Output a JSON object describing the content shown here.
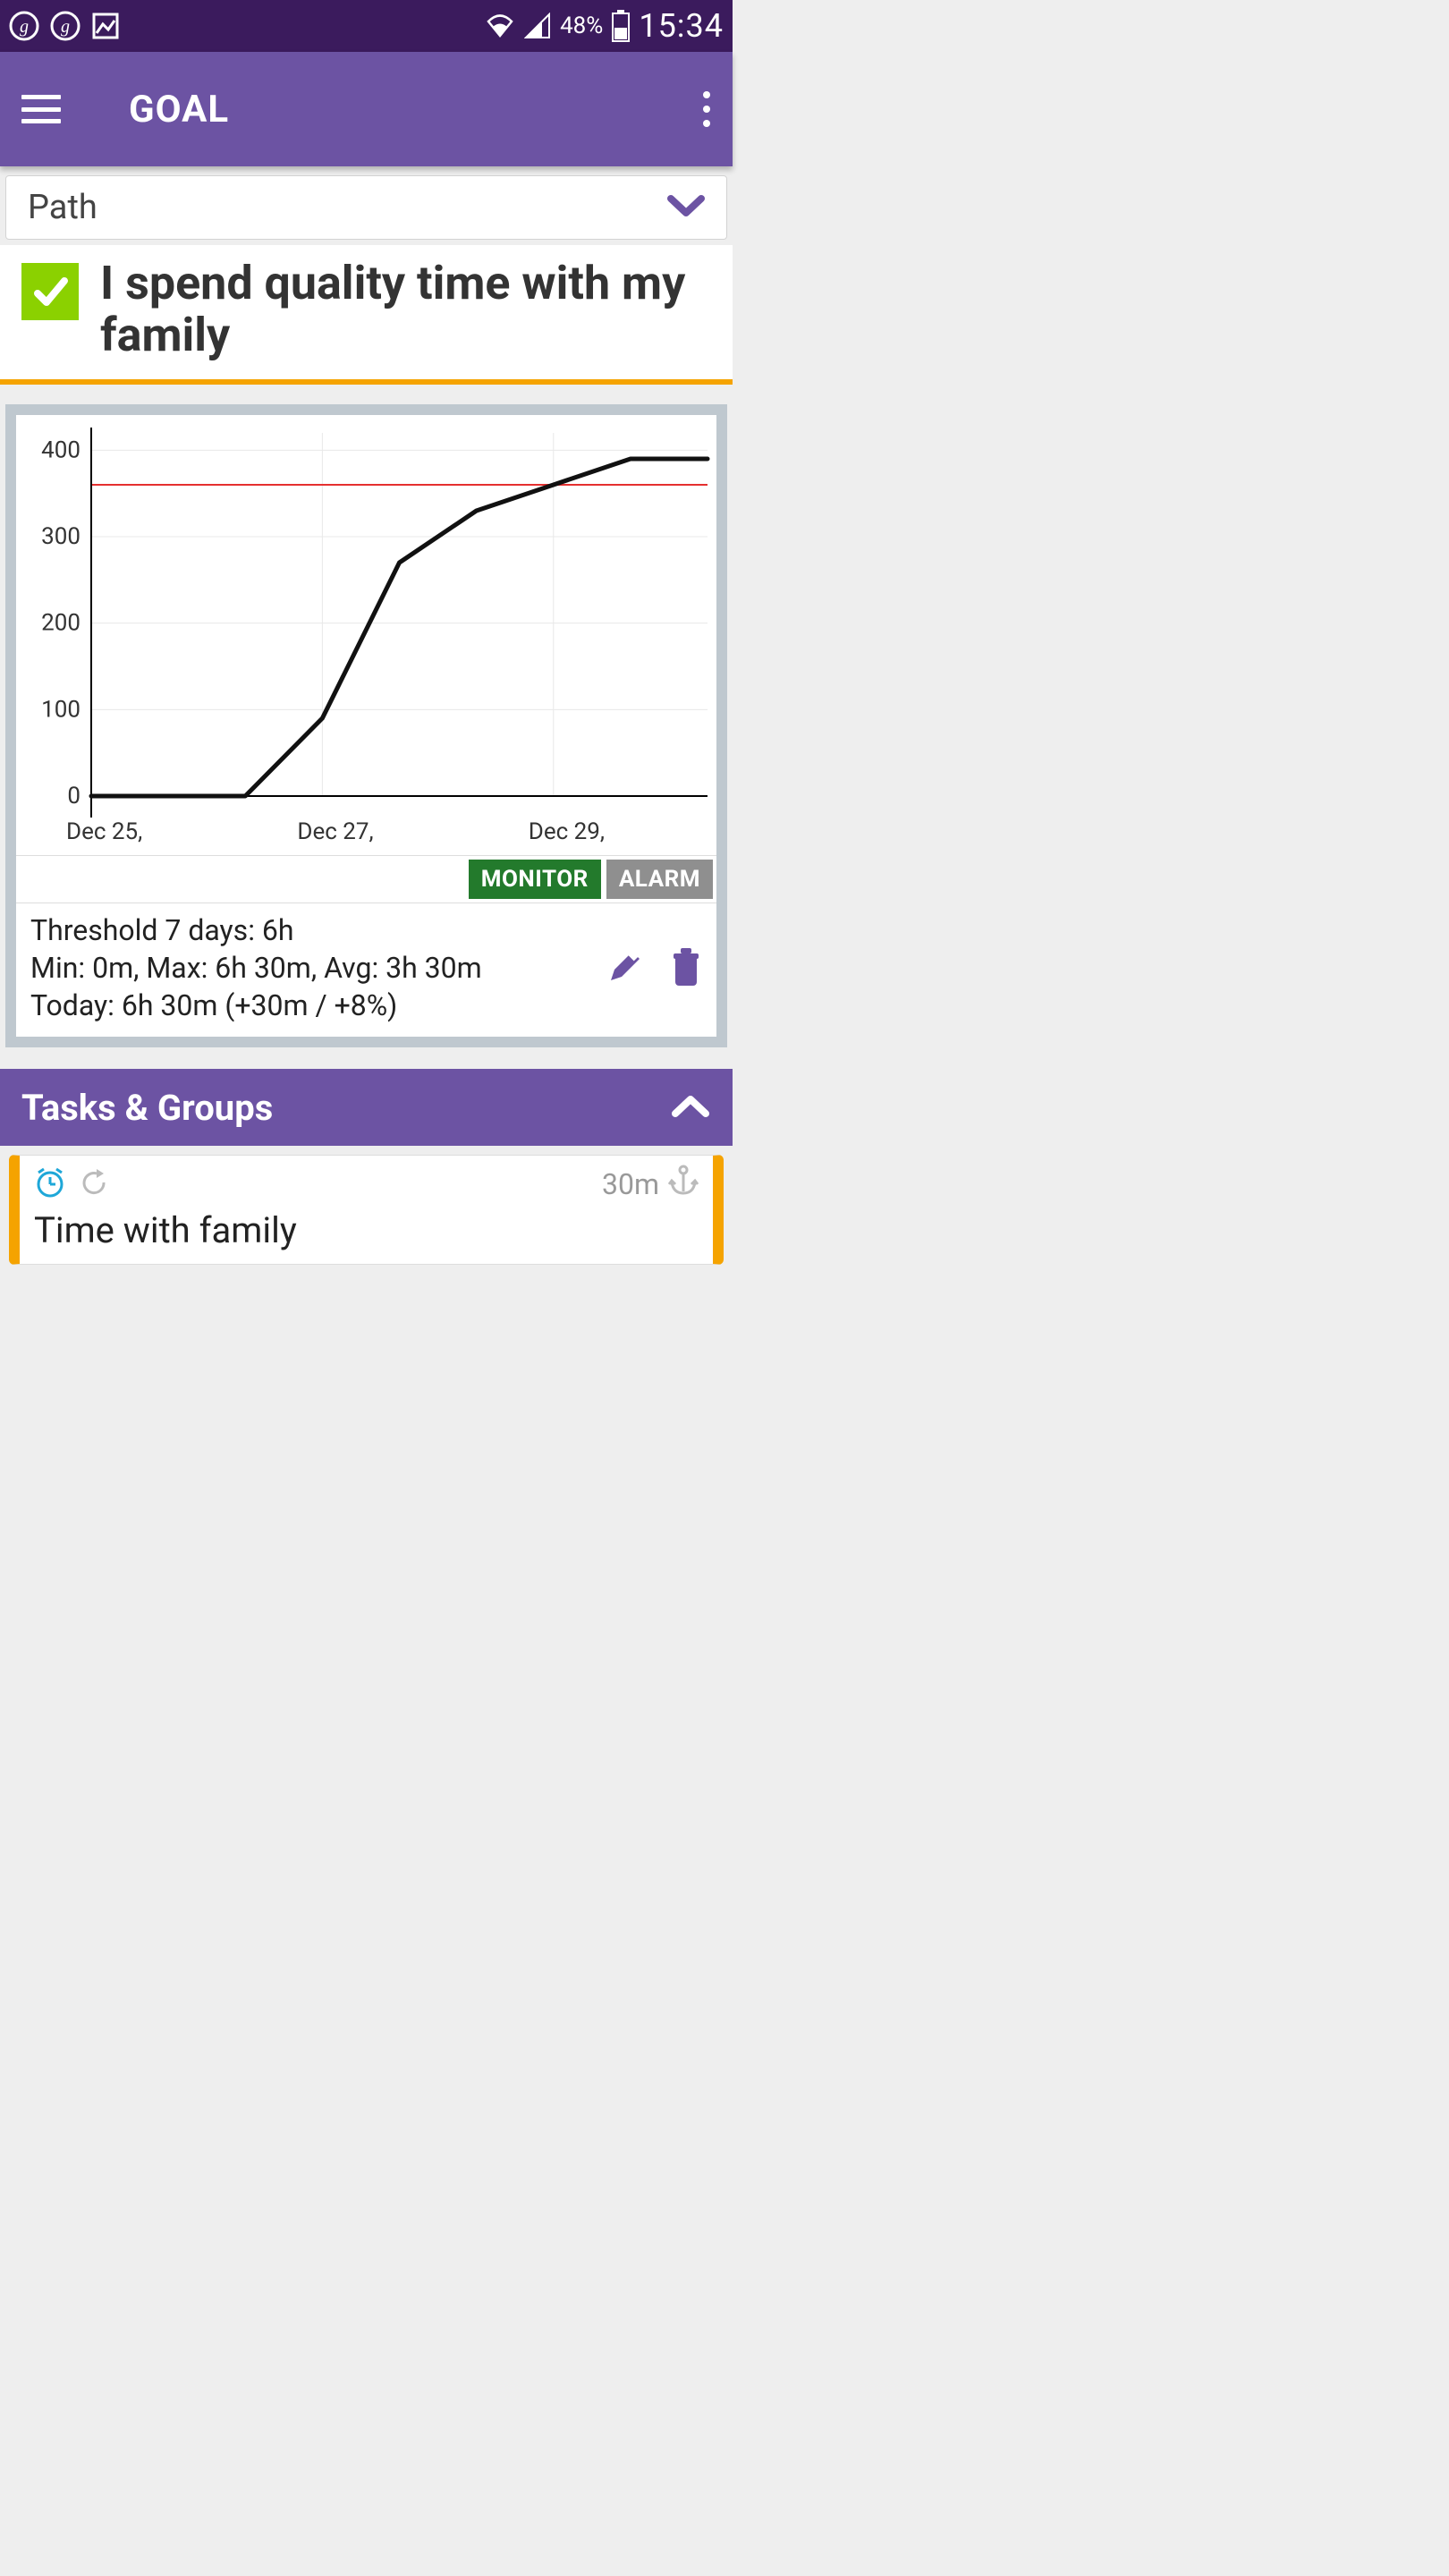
{
  "status": {
    "battery": "48%",
    "time": "15:34"
  },
  "appbar": {
    "title": "GOAL"
  },
  "path": {
    "label": "Path"
  },
  "goal": {
    "title": "I spend quality time with my family"
  },
  "chart_buttons": {
    "monitor": "MONITOR",
    "alarm": "ALARM"
  },
  "chart_stats": {
    "line1": "Threshold 7 days: 6h",
    "line2": "Min: 0m, Max: 6h 30m, Avg: 3h 30m",
    "line3": "Today: 6h 30m (+30m / +8%)"
  },
  "section": {
    "tasks": "Tasks & Groups"
  },
  "task": {
    "title": "Time with family",
    "duration": "30m"
  },
  "chart_data": {
    "type": "line",
    "title": "",
    "xlabel": "",
    "ylabel": "",
    "ylim": [
      0,
      420
    ],
    "y_ticks": [
      0,
      100,
      200,
      300,
      400
    ],
    "x_ticks": [
      "Dec 25,",
      "Dec 27,",
      "Dec 29,"
    ],
    "threshold": 360,
    "categories": [
      "Dec 25",
      "Dec 25.5",
      "Dec 26",
      "Dec 27",
      "Dec 28",
      "Dec 29",
      "Dec 29.5",
      "Dec 30",
      "Dec 30.5"
    ],
    "values": [
      0,
      0,
      0,
      90,
      270,
      330,
      360,
      390,
      390
    ]
  }
}
